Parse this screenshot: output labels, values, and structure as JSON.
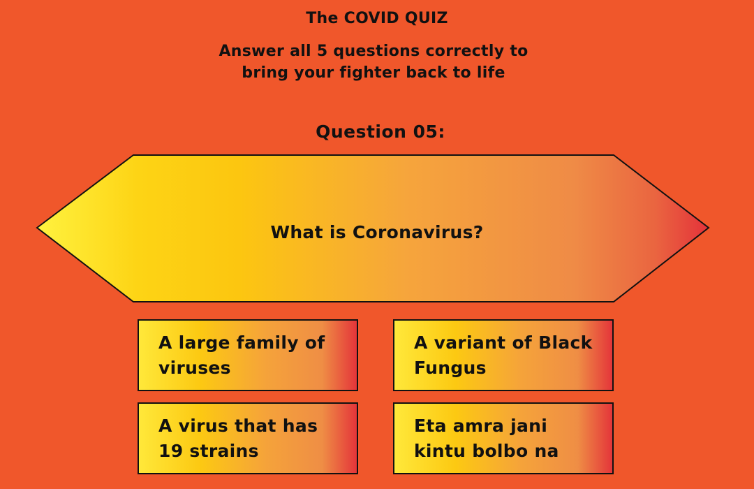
{
  "quiz": {
    "title": "The COVID QUIZ",
    "instructions": "Answer all 5 questions correctly to bring your fighter back to life",
    "question_label": "Question 05:",
    "question_text": "What is Coronavirus?",
    "options": [
      "A large family of viruses",
      "A variant of Black Fungus",
      "A virus that has 19 strains",
      "Eta amra jani kintu bolbo na"
    ]
  },
  "colors": {
    "background": "#f0572b",
    "gradient_start": "#ffe83a",
    "gradient_mid": "#fcc912",
    "gradient_end": "#e4353a",
    "border": "#111111"
  }
}
